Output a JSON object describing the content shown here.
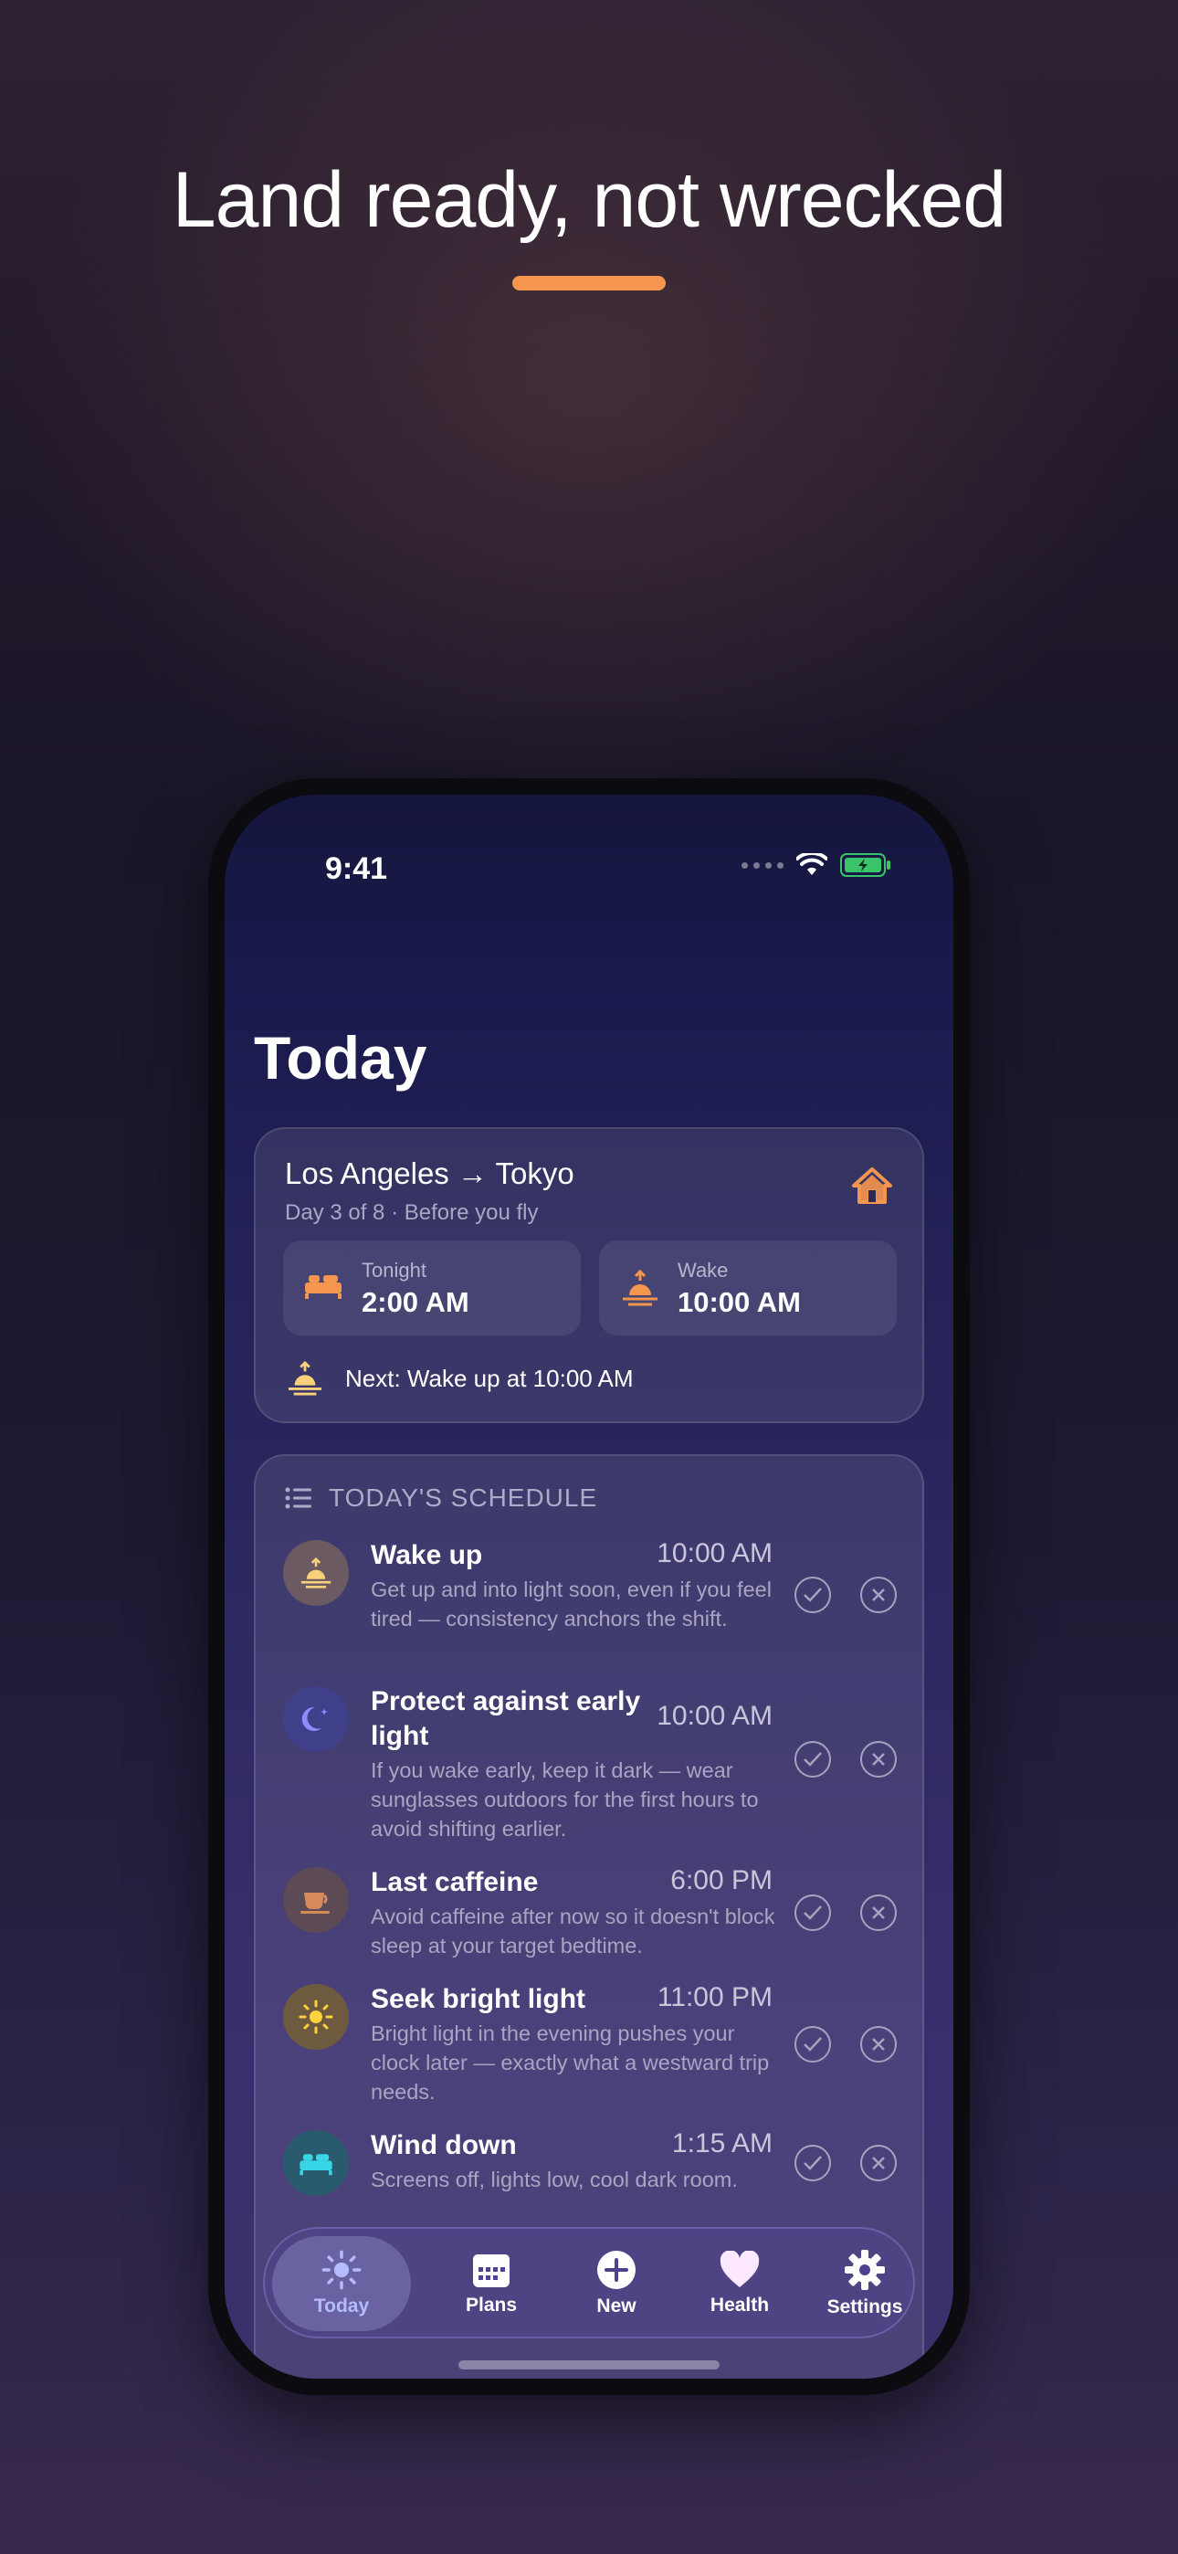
{
  "headline": "Land ready, not wrecked",
  "status": {
    "time": "9:41"
  },
  "page_title": "Today",
  "trip": {
    "route": "Los Angeles → Tokyo",
    "subtitle": "Day 3 of 8 · Before you fly",
    "tonight_label": "Tonight",
    "tonight_value": "2:00 AM",
    "wake_label": "Wake",
    "wake_value": "10:00 AM",
    "next": "Next: Wake up at 10:00 AM"
  },
  "schedule": {
    "header": "TODAY'S SCHEDULE",
    "items": [
      {
        "title": "Wake up",
        "time": "10:00 AM",
        "desc": "Get up and into light soon, even if you feel tired — consistency anchors the shift.",
        "icon": "sunrise-icon",
        "color": "#6b5a62"
      },
      {
        "title": "Protect against early light",
        "time": "10:00 AM",
        "desc": "If you wake early, keep it dark — wear sunglasses outdoors for the first hours to avoid shifting earlier.",
        "icon": "moon-icon",
        "color": "#3f3f8a"
      },
      {
        "title": "Last caffeine",
        "time": "6:00 PM",
        "desc": "Avoid caffeine after now so it doesn't block sleep at your target bedtime.",
        "icon": "coffee-icon",
        "color": "#5c4a55"
      },
      {
        "title": "Seek bright light",
        "time": "11:00 PM",
        "desc": "Bright light in the evening pushes your clock later — exactly what a westward trip needs.",
        "icon": "sun-icon",
        "color": "#6e5a3e"
      },
      {
        "title": "Wind down",
        "time": "1:15 AM",
        "desc": "Screens off, lights low, cool dark room.",
        "icon": "bed-icon",
        "color": "#2a5a6e"
      }
    ]
  },
  "tabs": [
    {
      "label": "Today",
      "icon": "sun-icon"
    },
    {
      "label": "Plans",
      "icon": "calendar-icon"
    },
    {
      "label": "New",
      "icon": "plus-icon"
    },
    {
      "label": "Health",
      "icon": "heart-icon"
    },
    {
      "label": "Settings",
      "icon": "gear-icon"
    }
  ],
  "colors": {
    "accent": "#f5964f",
    "tab_active": "#b4bcff"
  }
}
